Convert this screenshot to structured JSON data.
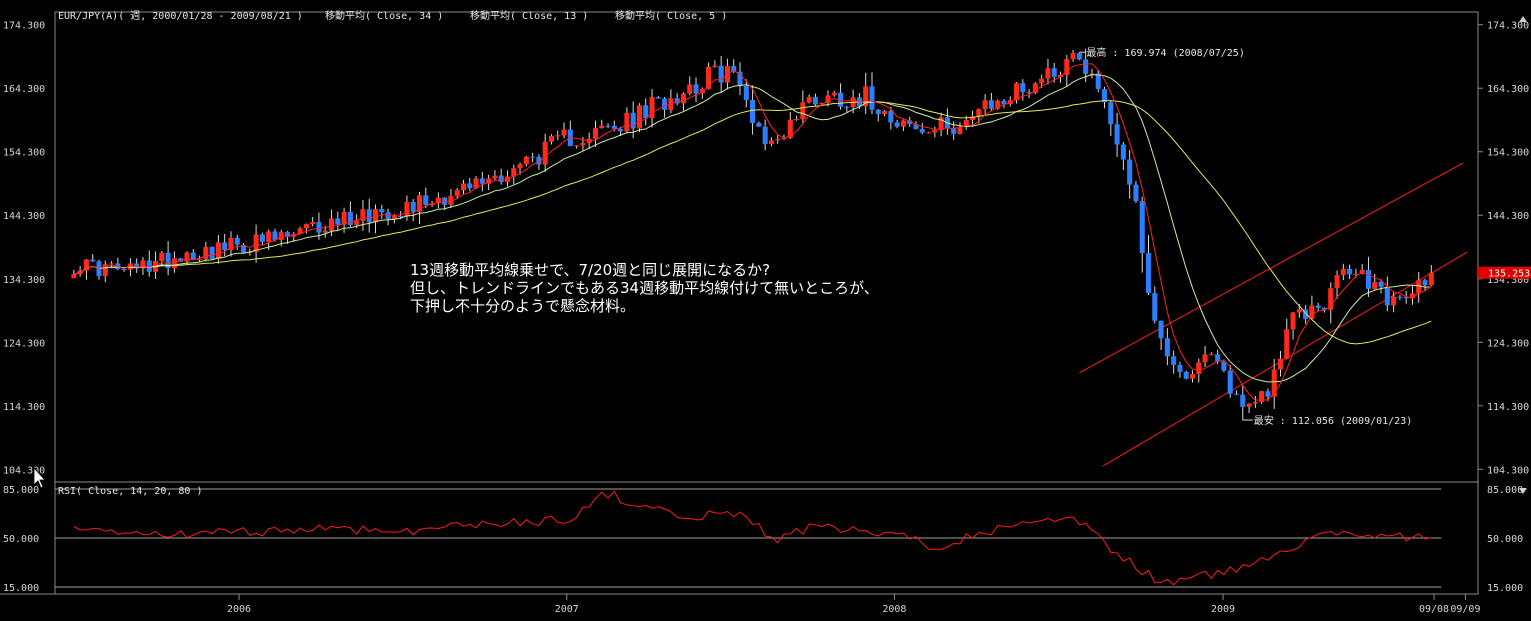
{
  "header": {
    "symbol_line": "EUR/JPY(A)( 週, 2000/01/28 - 2009/08/21 )",
    "ma_labels": [
      "移動平均( Close, 34 )",
      "移動平均( Close, 13 )",
      "移動平均( Close, 5 )"
    ]
  },
  "rsi_panel": {
    "title": "RSI( Close, 14, 20, 80 )"
  },
  "colors": {
    "background": "#000000",
    "up_candle": "#ff2a1a",
    "down_candle": "#2a7fff",
    "ma34": "#e8e85a",
    "ma13": "#c8f0a0",
    "ma5": "#ff2020",
    "trendline": "#ff1a1a",
    "rsi_line": "#ff1a1a",
    "price_badge": "#e00000"
  },
  "annotation": {
    "lines": [
      "13週移動平均線乗せで、7/20週と同じ展開になるか?",
      "但し、トレンドラインでもある34週移動平均線付けて無いところが、",
      "下押し不十分のようで懸念材料。"
    ]
  },
  "markers": {
    "high_label": "最高 : 169.974 (2008/07/25)",
    "low_label": "最安 : 112.056 (2009/01/23)",
    "current_price": "135.253"
  },
  "chart_data": [
    {
      "type": "candlestick",
      "title": "EUR/JPY(A)( 週, 2000/01/28 - 2009/08/21 )",
      "series_names": [
        "移動平均( Close, 34 )",
        "移動平均( Close, 13 )",
        "移動平均( Close, 5 )"
      ],
      "ylim": [
        102.3,
        176.3
      ],
      "y_ticks": [
        "174.300",
        "164.300",
        "154.300",
        "144.300",
        "134.300",
        "124.300",
        "114.300",
        "104.300"
      ],
      "x_ticks": [
        "2006",
        "2007",
        "2008",
        "2009",
        "09/08",
        "09/09"
      ],
      "close_path": [
        [
          "2005-07-01",
          136.5
        ],
        [
          "2005-09-01",
          135.5
        ],
        [
          "2005-11-01",
          138.3
        ],
        [
          "2006-01-01",
          139.5
        ],
        [
          "2006-03-01",
          141.0
        ],
        [
          "2006-05-01",
          144.0
        ],
        [
          "2006-07-01",
          145.6
        ],
        [
          "2006-09-01",
          148.0
        ],
        [
          "2006-11-01",
          151.5
        ],
        [
          "2007-01-01",
          156.5
        ],
        [
          "2007-03-01",
          158.0
        ],
        [
          "2007-05-01",
          163.5
        ],
        [
          "2007-07-01",
          167.5
        ],
        [
          "2007-08-15",
          155.0
        ],
        [
          "2007-10-01",
          163.0
        ],
        [
          "2007-12-01",
          163.0
        ],
        [
          "2008-02-01",
          157.0
        ],
        [
          "2008-04-01",
          160.0
        ],
        [
          "2008-06-01",
          165.0
        ],
        [
          "2008-07-25",
          169.9
        ],
        [
          "2008-08-20",
          163.0
        ],
        [
          "2008-09-20",
          150.0
        ],
        [
          "2008-10-20",
          125.0
        ],
        [
          "2008-11-20",
          119.0
        ],
        [
          "2008-12-20",
          122.0
        ],
        [
          "2009-01-23",
          114.0
        ],
        [
          "2009-02-20",
          117.0
        ],
        [
          "2009-03-20",
          128.0
        ],
        [
          "2009-04-20",
          130.0
        ],
        [
          "2009-05-20",
          136.0
        ],
        [
          "2009-06-20",
          133.0
        ],
        [
          "2009-07-15",
          130.0
        ],
        [
          "2009-08-21",
          135.253
        ]
      ],
      "high": {
        "value": 169.974,
        "date": "2008-07-25"
      },
      "low": {
        "value": 112.056,
        "date": "2009-01-23"
      },
      "current": 135.253,
      "trendlines": [
        {
          "from": [
            "2008-07-25",
            119.5
          ],
          "to": [
            "2009-09-25",
            152.5
          ]
        },
        {
          "from": [
            "2008-08-20",
            104.8
          ],
          "to": [
            "2009-09-30",
            138.5
          ]
        }
      ]
    },
    {
      "type": "line",
      "title": "RSI( Close, 14, 20, 80 )",
      "ylim": [
        10,
        90
      ],
      "y_ticks": [
        "85.000",
        "50.000",
        "15.000"
      ],
      "levels": [
        85,
        50,
        15
      ],
      "rsi_path": [
        [
          "2005-07-01",
          55
        ],
        [
          "2005-10-01",
          52
        ],
        [
          "2006-01-01",
          54
        ],
        [
          "2006-04-01",
          57
        ],
        [
          "2006-07-01",
          55
        ],
        [
          "2006-10-01",
          60
        ],
        [
          "2007-01-01",
          63
        ],
        [
          "2007-02-15",
          82
        ],
        [
          "2007-05-01",
          65
        ],
        [
          "2007-07-20",
          68
        ],
        [
          "2007-08-15",
          48
        ],
        [
          "2007-10-01",
          58
        ],
        [
          "2008-01-01",
          52
        ],
        [
          "2008-02-15",
          44
        ],
        [
          "2008-04-15",
          55
        ],
        [
          "2008-06-01",
          60
        ],
        [
          "2008-07-25",
          62
        ],
        [
          "2008-09-01",
          40
        ],
        [
          "2008-10-24",
          18
        ],
        [
          "2008-12-01",
          22
        ],
        [
          "2009-01-23",
          28
        ],
        [
          "2009-03-01",
          40
        ],
        [
          "2009-05-01",
          55
        ],
        [
          "2009-06-15",
          52
        ],
        [
          "2009-08-21",
          50
        ]
      ]
    }
  ]
}
